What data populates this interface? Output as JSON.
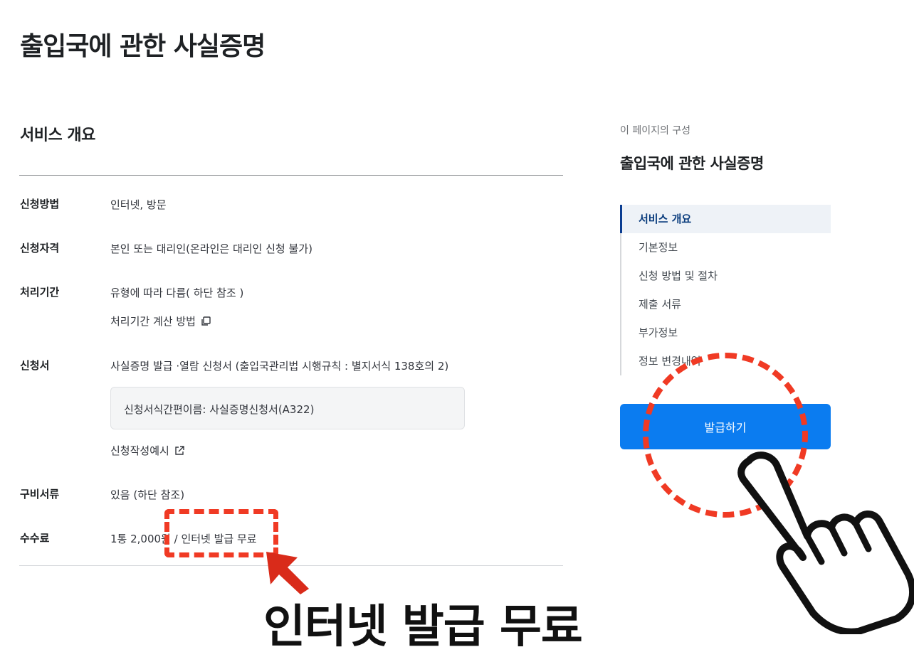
{
  "page": {
    "title": "출입국에 관한 사실증명",
    "section_heading": "서비스 개요"
  },
  "overview": {
    "rows": [
      {
        "label": "신청방법",
        "value": "인터넷, 방문"
      },
      {
        "label": "신청자격",
        "value": "본인 또는 대리인(온라인은 대리인 신청 불가)"
      },
      {
        "label": "처리기간",
        "value": "유형에 따라 다름( 하단 참조 )",
        "link": "처리기간 계산 방법"
      },
      {
        "label": "신청서",
        "value": "사실증명 발급 ·열람 신청서 (출입국관리법 시행규칙 : 별지서식 138호의 2)",
        "box": "신청서식간편이름: 사실증명신청서(A322)",
        "link": "신청작성예시"
      },
      {
        "label": "구비서류",
        "value": "있음 (하단 참조)"
      },
      {
        "label": "수수료",
        "value": "1통 2,000원 / 인터넷 발급 무료"
      }
    ]
  },
  "callout": {
    "text": "인터넷 발급 무료",
    "highlight_color": "#f03a24"
  },
  "toc": {
    "caption": "이 페이지의 구성",
    "title": "출입국에 관한 사실증명",
    "items": [
      {
        "label": "서비스 개요",
        "active": true
      },
      {
        "label": "기본정보"
      },
      {
        "label": "신청 방법 및 절차"
      },
      {
        "label": "제출 서류"
      },
      {
        "label": "부가정보"
      },
      {
        "label": "정보 변경내역"
      }
    ]
  },
  "actions": {
    "issue_label": "발급하기",
    "accent_color": "#0b7cf0"
  },
  "icons": [
    "copy-icon",
    "external-link-icon",
    "red-arrow-icon",
    "pointing-hand-icon"
  ]
}
